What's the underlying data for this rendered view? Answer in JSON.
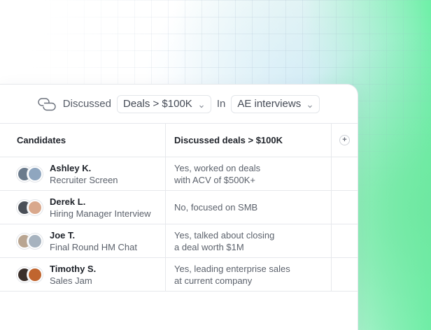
{
  "filter": {
    "icon": "chat-bubbles-icon",
    "prefix": "Discussed",
    "topic": "Deals > $100K",
    "in_label": "In",
    "scope": "AE interviews"
  },
  "table": {
    "headers": {
      "candidates": "Candidates",
      "question": "Discussed deals > $100K",
      "add_column": "+"
    },
    "rows": [
      {
        "name": "Ashley K.",
        "stage": "Recruiter Screen",
        "answer": "Yes, worked on deals\nwith ACV of $500K+",
        "avatar_colors": [
          "#6b7b8c",
          "#8fa6bf"
        ]
      },
      {
        "name": "Derek L.",
        "stage": "Hiring Manager Interview",
        "answer": "No, focused on SMB",
        "avatar_colors": [
          "#4a4f57",
          "#d9a88c"
        ]
      },
      {
        "name": "Joe T.",
        "stage": "Final Round HM Chat",
        "answer": "Yes, talked about closing\na deal worth $1M",
        "avatar_colors": [
          "#b9a591",
          "#a7b3bf"
        ]
      },
      {
        "name": "Timothy S.",
        "stage": "Sales Jam",
        "answer": "Yes, leading enterprise sales\nat current company",
        "avatar_colors": [
          "#3b2f2a",
          "#c0652f"
        ]
      }
    ]
  },
  "colors": {
    "accent_green": "#6ff0a8",
    "border": "#e6e8ec",
    "text_primary": "#1e2229",
    "text_secondary": "#5c626c"
  }
}
